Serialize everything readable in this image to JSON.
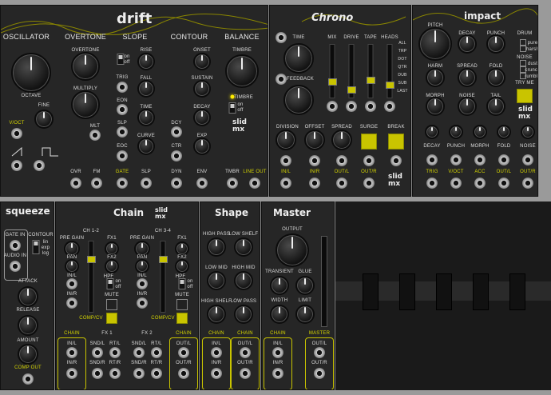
{
  "drift": {
    "brand": "drift",
    "headers": [
      "OSCILLATOR",
      "OVERTONE",
      "SLOPE",
      "CONTOUR",
      "BALANCE"
    ],
    "labels": {
      "octave": "OCTAVE",
      "fine": "FINE",
      "voct": "V/OCT",
      "overtone": "OVERTONE",
      "multiply": "MULTIPLY",
      "mlt": "MLT",
      "rise": "RISE",
      "fall": "FALL",
      "time": "TIME",
      "curve": "CURVE",
      "on": "on",
      "off": "off",
      "trig": "TRIG",
      "eon": "EON",
      "slp": "SLP",
      "eoc": "EOC",
      "onset": "ONSET",
      "sustain": "SUSTAIN",
      "decay": "DECAY",
      "exp": "EXP",
      "dcy": "DCY",
      "ctr": "CTR",
      "timbre": "TIMBRE",
      "timbre_sw": "TIMBRE",
      "ovr": "OVR",
      "fm": "FM",
      "gate": "GATE",
      "slp_out": "SLP",
      "dyn": "DYN",
      "env": "ENV",
      "tmbr": "TMBR",
      "line_out": "LINE OUT"
    }
  },
  "chrono": {
    "brand": "Chrono",
    "labels": {
      "time": "TIME",
      "feedback": "FEEDBACK",
      "mix": "MIX",
      "drive": "DRIVE",
      "tape": "TAPE",
      "heads": "HEADS",
      "head_opts": [
        "ALL",
        "TRP",
        "DOT",
        "QTR",
        "DUB",
        "SUB",
        "LAST"
      ],
      "division": "DIVISION",
      "offset": "OFFSET",
      "spread": "SPREAD",
      "surge": "SURGE",
      "break": "BREAK",
      "in_l": "IN/L",
      "in_r": "IN/R",
      "out_l": "OUT/L",
      "out_r": "OUT/R"
    }
  },
  "impact": {
    "brand": "impact",
    "labels": {
      "pitch": "PITCH",
      "decay": "DECAY",
      "punch": "PUNCH",
      "drum": "DRUM",
      "pure": "pure",
      "harsh": "harsh",
      "harm": "HARM",
      "spread": "SPREAD",
      "fold": "FOLD",
      "noise": "NOISE",
      "dust": "dust",
      "crunch": "crunch",
      "rumble": "rumble",
      "morph": "MORPH",
      "noise2": "NOISE",
      "tail": "TAIL",
      "try_me": "TRY ME",
      "row": [
        "DECAY",
        "PUNCH",
        "MORPH",
        "FOLD",
        "NOISE"
      ],
      "jacks": [
        "TRIG",
        "V/OCT",
        "ACC",
        "OUT/L",
        "OUT/R"
      ]
    }
  },
  "squeeze": {
    "brand": "squeeze",
    "labels": {
      "gate_in": "GATE IN",
      "audio_in": "AUDIO IN",
      "contour": "CONTOUR",
      "lin": "lin",
      "exp": "exp",
      "log": "log",
      "attack": "ATTACK",
      "release": "RELEASE",
      "amount": "AMOUNT",
      "comp_out": "COMP OUT"
    }
  },
  "chain": {
    "brand": "Chain",
    "ch12": "CH 1-2",
    "ch34": "CH 3-4",
    "labels": {
      "pre_gain": "PRE GAIN",
      "fx1": "FX1",
      "fx2": "FX2",
      "pan": "PAN",
      "in_l": "IN/L",
      "in_r": "IN/R",
      "hpf": "HPF",
      "on": "on",
      "off": "off",
      "mute": "MUTE",
      "comp_cv": "COMP/CV",
      "chain": "CHAIN",
      "fx1_box": "FX 1",
      "fx2_box": "FX 2",
      "snd_l": "SND/L",
      "snd_r": "SND/R",
      "rt_l": "RT/L",
      "rt_r": "RT/R",
      "out_l": "OUT/L",
      "out_r": "OUT/R"
    }
  },
  "shape": {
    "brand": "Shape",
    "labels": {
      "high_pass": "HIGH PASS",
      "low_shelf": "LOW SHELF",
      "low_mid": "LOW MID",
      "high_mid": "HIGH MID",
      "high_shelf": "HIGH SHELF",
      "low_pass": "LOW PASS",
      "chain": "CHAIN",
      "in_l": "IN/L",
      "in_r": "IN/R",
      "out_l": "OUT/L",
      "out_r": "OUT/R"
    }
  },
  "master": {
    "brand": "Master",
    "labels": {
      "output": "OUTPUT",
      "transient": "TRANSIENT",
      "glue": "GLUE",
      "width": "WIDTH",
      "limit": "LIMIT",
      "chain": "CHAIN",
      "in_l": "IN/L",
      "in_r": "IN/R",
      "master": "MASTER",
      "out_l": "OUT/L",
      "out_r": "OUT/R"
    }
  },
  "logo": "slid\nmx",
  "colors": {
    "panel": "#262626",
    "accent": "#c9c400",
    "rack": "#8a8a8a"
  }
}
